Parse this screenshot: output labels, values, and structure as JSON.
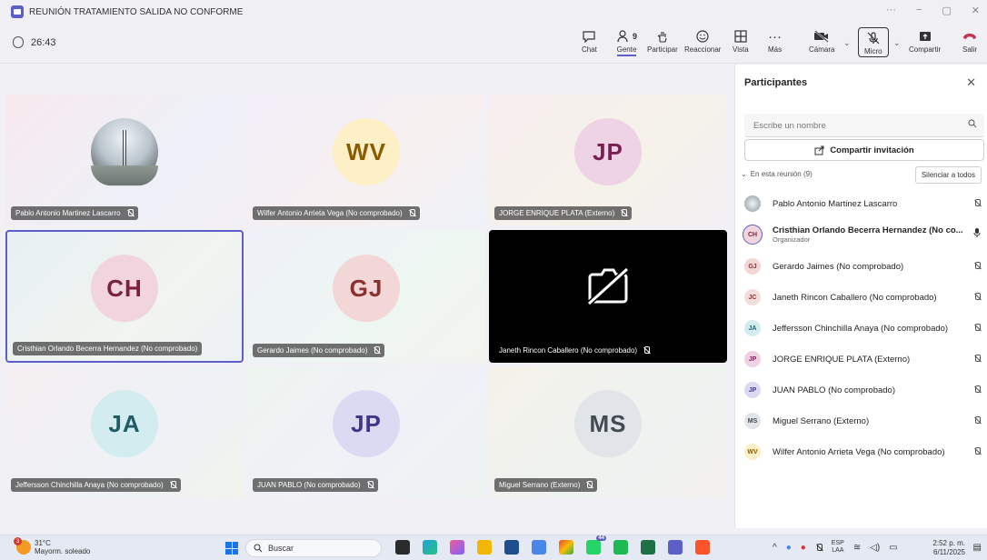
{
  "window": {
    "title": "REUNIÓN TRATAMIENTO SALIDA NO CONFORME",
    "controls": [
      "···",
      "−",
      "▢",
      "✕"
    ]
  },
  "toolbar": {
    "timer": "26:43",
    "chat": "Chat",
    "people": "Gente",
    "people_count": "9",
    "raise": "Participar",
    "react": "Reaccionar",
    "view": "Vista",
    "more": "Más",
    "camera": "Cámara",
    "mic": "Micro",
    "share": "Compartir",
    "leave": "Salir"
  },
  "tiles": [
    {
      "name": "Pablo Antonio Martinez Lascarro",
      "initials": ""
    },
    {
      "name": "Wilfer Antonio Arrieta Vega (No comprobado)",
      "initials": "WV",
      "bg": "#fdf0c7",
      "fg": "#8a5a00"
    },
    {
      "name": "JORGE ENRIQUE PLATA (Externo)",
      "initials": "JP",
      "bg": "#edd3e4",
      "fg": "#7a1f52"
    },
    {
      "name": "Cristhian Orlando Becerra Hernandez (No comprobado)",
      "initials": "CH",
      "bg": "#f1d4dd",
      "fg": "#7a2040"
    },
    {
      "name": "Gerardo Jaimes (No comprobado)",
      "initials": "GJ",
      "bg": "#f3d6d6",
      "fg": "#8a3030"
    },
    {
      "name": "Janeth Rincon Caballero (No comprobado)",
      "initials": ""
    },
    {
      "name": "Jeffersson Chinchilla Anaya (No comprobado)",
      "initials": "JA",
      "bg": "#d3ecf0",
      "fg": "#1f5c66"
    },
    {
      "name": "JUAN PABLO (No comprobado)",
      "initials": "JP",
      "bg": "#dcdaf3",
      "fg": "#3e3787"
    },
    {
      "name": "Miguel Serrano (Externo)",
      "initials": "MS",
      "bg": "#e1e4e8",
      "fg": "#424a52"
    }
  ],
  "panel": {
    "title": "Participantes",
    "search_placeholder": "Escribe un nombre",
    "invite": "Compartir invitación",
    "section": "En esta reunión (9)",
    "mute_all": "Silenciar a todos",
    "people": [
      {
        "name": "Pablo Antonio Martinez Lascarro",
        "initials": "",
        "sub": ""
      },
      {
        "name": "Cristhian Orlando Becerra Hernandez (No co...",
        "initials": "CH",
        "sub": "Organizador"
      },
      {
        "name": "Gerardo Jaimes (No comprobado)",
        "initials": "GJ",
        "sub": ""
      },
      {
        "name": "Janeth Rincon Caballero (No comprobado)",
        "initials": "JC",
        "sub": ""
      },
      {
        "name": "Jeffersson Chinchilla Anaya (No comprobado)",
        "initials": "JA",
        "sub": ""
      },
      {
        "name": "JORGE ENRIQUE PLATA (Externo)",
        "initials": "JP",
        "sub": ""
      },
      {
        "name": "JUAN PABLO (No comprobado)",
        "initials": "JP",
        "sub": ""
      },
      {
        "name": "Miguel Serrano (Externo)",
        "initials": "MS",
        "sub": ""
      },
      {
        "name": "Wilfer Antonio Arrieta Vega (No comprobado)",
        "initials": "WV",
        "sub": ""
      }
    ]
  },
  "taskbar": {
    "badge": "3",
    "temp": "31°C",
    "weather": "Mayorm. soleado",
    "search": "Buscar",
    "lang1": "ESP",
    "lang2": "LAA",
    "time": "2:52 p. m.",
    "date": "6/11/2025",
    "app_badge": "44"
  }
}
